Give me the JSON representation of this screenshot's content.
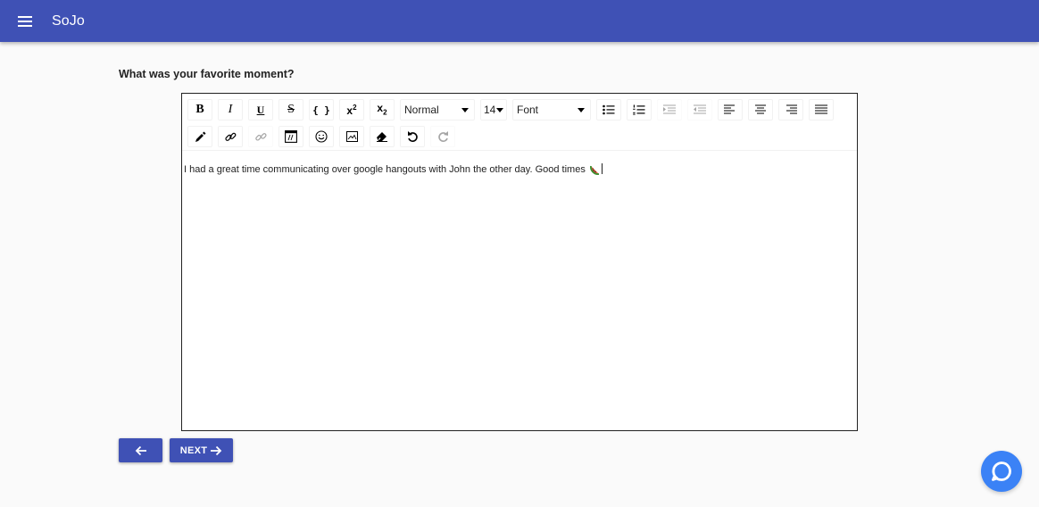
{
  "app": {
    "title": "SoJo"
  },
  "question": {
    "label": "What was your favorite moment?"
  },
  "toolbar": {
    "block_type": "Normal",
    "font_size": "14",
    "font_family": "Font",
    "row1_icons": [
      "bold-icon",
      "italic-icon",
      "underline-icon",
      "strikethrough-icon",
      "code-icon",
      "superscript-icon",
      "subscript-icon"
    ],
    "list_align_icons": [
      "unordered-list-icon",
      "ordered-list-icon",
      "indent-icon",
      "outdent-icon",
      "align-left-icon",
      "align-center-icon",
      "align-right-icon",
      "align-justify-icon"
    ],
    "row2_icons": [
      "color-picker-icon",
      "link-icon",
      "unlink-icon",
      "embedded-icon",
      "emoji-icon",
      "image-icon",
      "eraser-icon",
      "undo-icon",
      "redo-icon"
    ]
  },
  "editor": {
    "text": "I had a great time communicating over google hangouts with John the other day. Good times",
    "emoji": "watermelon-emoji"
  },
  "buttons": {
    "next_label": "NEXT"
  },
  "colors": {
    "primary": "#3f51b5",
    "chat": "#3b82f6",
    "background": "#fafafa"
  }
}
